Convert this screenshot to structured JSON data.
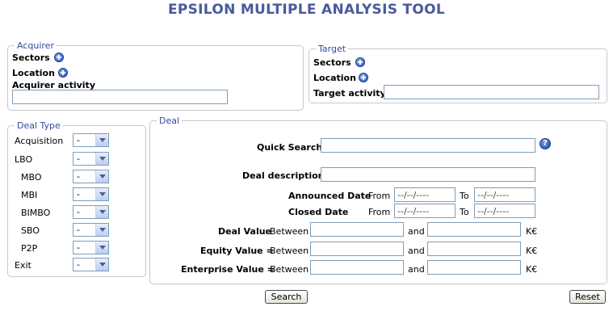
{
  "page": {
    "title": "EPSILON MULTIPLE ANALYSIS TOOL"
  },
  "acquirer": {
    "legend": "Acquirer",
    "sectors_label": "Sectors",
    "location_label": "Location",
    "activity_label": "Acquirer activity",
    "activity_value": ""
  },
  "target": {
    "legend": "Target",
    "sectors_label": "Sectors",
    "location_label": "Location",
    "activity_label": "Target activity",
    "activity_value": ""
  },
  "deal_type": {
    "legend": "Deal Type",
    "rows": [
      {
        "label": "Acquisition",
        "value": "-"
      },
      {
        "label": "LBO",
        "value": "-"
      },
      {
        "label": "MBO",
        "value": "-"
      },
      {
        "label": "MBI",
        "value": "-"
      },
      {
        "label": "BIMBO",
        "value": "-"
      },
      {
        "label": "SBO",
        "value": "-"
      },
      {
        "label": "P2P",
        "value": "-"
      },
      {
        "label": "Exit",
        "value": "-"
      }
    ]
  },
  "deal": {
    "legend": "Deal",
    "quick_search_label": "Quick Search",
    "quick_search_value": "",
    "help_icon": "help-icon",
    "description_label": "Deal description",
    "description_value": "",
    "announced_label": "Announced Date",
    "closed_label": "Closed Date",
    "from_label": "From",
    "to_label": "To",
    "date_placeholder": "--/--/----",
    "deal_value_label": "Deal Value",
    "equity_value_label": "Equity Value =",
    "enterprise_value_label": "Enterprise Value =",
    "between_label": "Between",
    "and_label": "and",
    "currency": "K€"
  },
  "buttons": {
    "search": "Search",
    "reset": "Reset"
  },
  "colors": {
    "title": "#4a5a9c",
    "legend": "#2e4d9c",
    "border": "#c8c8c8",
    "input_border": "#7f9db9"
  }
}
